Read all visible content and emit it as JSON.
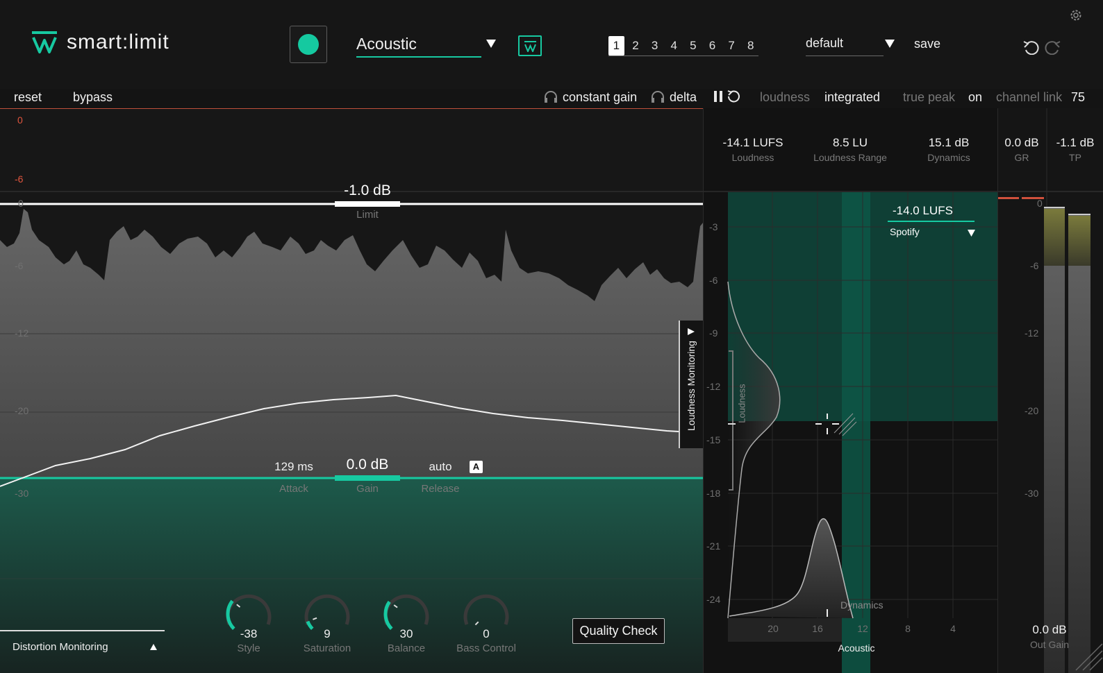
{
  "header": {
    "app_name": "smart:limit",
    "profile_value": "Acoustic",
    "preset_slots": [
      "1",
      "2",
      "3",
      "4",
      "5",
      "6",
      "7",
      "8"
    ],
    "active_slot": "1",
    "preset_name": "default",
    "save_label": "save"
  },
  "toolbar": {
    "reset_label": "reset",
    "bypass_label": "bypass",
    "constant_gain_label": "constant gain",
    "delta_label": "delta",
    "loudness_label": "loudness",
    "loudness_mode": "integrated",
    "true_peak_label": "true peak",
    "true_peak_value": "on",
    "channel_link_label": "channel link",
    "channel_link_value": "75"
  },
  "graph": {
    "scale_top": [
      "0",
      "-6"
    ],
    "scale_main": [
      "0",
      "-6",
      "-12",
      "-20",
      "-30"
    ],
    "limit_value": "-1.0 dB",
    "limit_label": "Limit",
    "attack_value": "129 ms",
    "attack_label": "Attack",
    "gain_value": "0.0 dB",
    "gain_label": "Gain",
    "release_value": "auto",
    "release_label": "Release",
    "auto_badge": "A",
    "loudness_monitoring_tab": "Loudness Monitoring",
    "distortion_monitoring_label": "Distortion Monitoring",
    "quality_check_label": "Quality Check",
    "knobs": [
      {
        "value": "-38",
        "label": "Style",
        "level": 0.31
      },
      {
        "value": "9",
        "label": "Saturation",
        "level": 0.09
      },
      {
        "value": "30",
        "label": "Balance",
        "level": 0.3
      },
      {
        "value": "0",
        "label": "Bass Control",
        "level": 0.0
      }
    ]
  },
  "stats": [
    {
      "value": "-14.1 LUFS",
      "label": "Loudness"
    },
    {
      "value": "8.5 LU",
      "label": "Loudness Range"
    },
    {
      "value": "15.1 dB",
      "label": "Dynamics"
    },
    {
      "value": "0.0 dB",
      "label": "GR"
    },
    {
      "value": "-1.1 dB",
      "label": "TP"
    }
  ],
  "loudness_panel": {
    "y_ticks": [
      "-3",
      "-6",
      "-9",
      "-12",
      "-15",
      "-18",
      "-21",
      "-24"
    ],
    "x_ticks": [
      "20",
      "16",
      "12",
      "8",
      "4"
    ],
    "target_value": "-14.0 LUFS",
    "target_platform": "Spotify",
    "loudness_axis_label": "Loudness",
    "dynamics_axis_label": "Dynamics",
    "profile_label": "Acoustic"
  },
  "meters": {
    "scale": [
      "0",
      "-6",
      "-12",
      "-20",
      "-30"
    ],
    "out_gain_value": "0.0 dB",
    "out_gain_label": "Out Gain"
  }
}
